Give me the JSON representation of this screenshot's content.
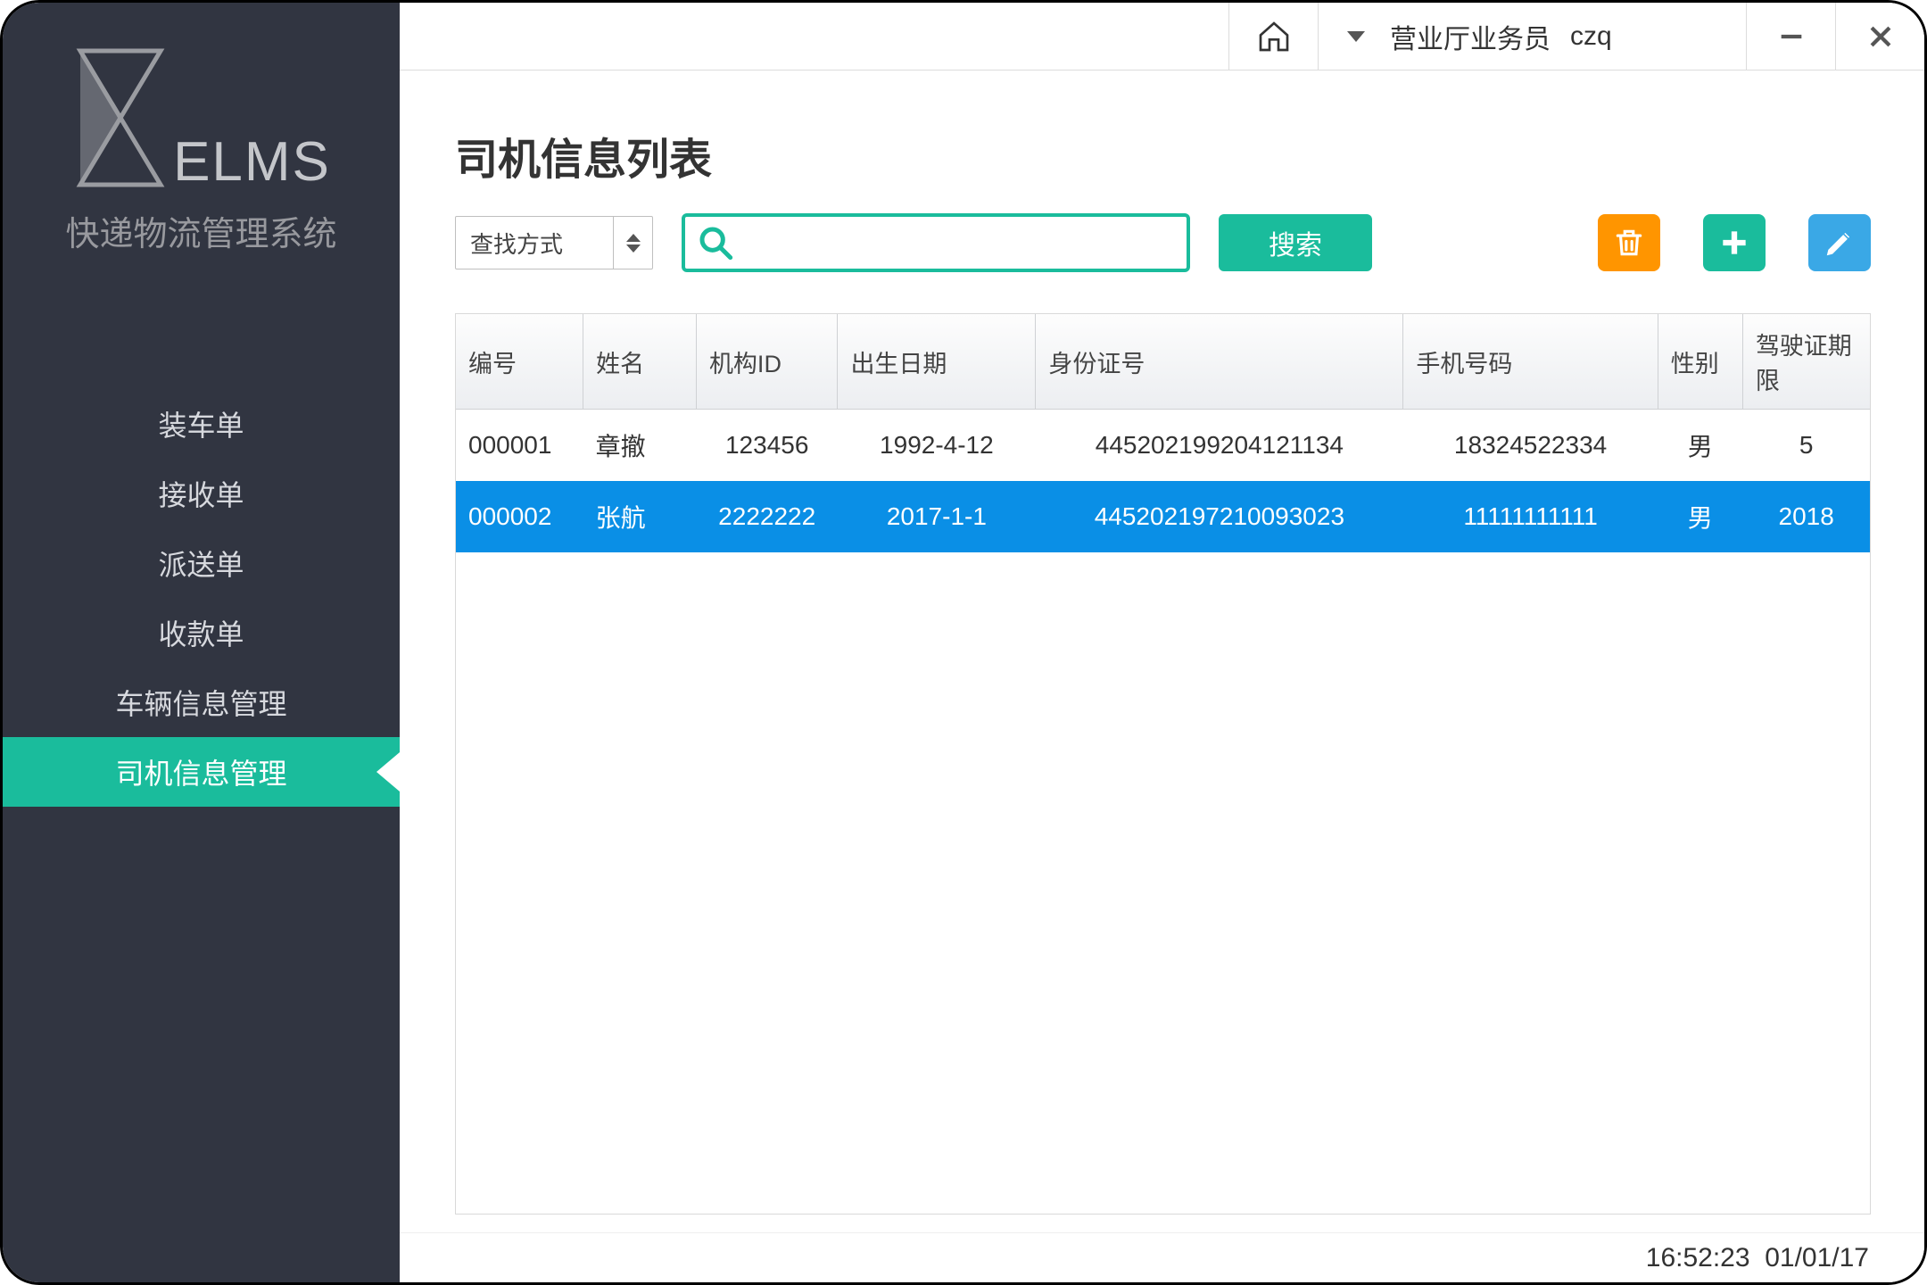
{
  "app": {
    "name": "ELMS",
    "subtitle": "快递物流管理系统"
  },
  "sidebar": {
    "items": [
      {
        "label": "装车单"
      },
      {
        "label": "接收单"
      },
      {
        "label": "派送单"
      },
      {
        "label": "收款单"
      },
      {
        "label": "车辆信息管理"
      },
      {
        "label": "司机信息管理"
      }
    ],
    "activeIndex": 5
  },
  "topbar": {
    "user_role": "营业厅业务员",
    "user_name": "czq"
  },
  "page": {
    "title": "司机信息列表"
  },
  "toolbar": {
    "select_label": "查找方式",
    "search_value": "",
    "search_button": "搜索"
  },
  "table": {
    "columns": [
      "编号",
      "姓名",
      "机构ID",
      "出生日期",
      "身份证号",
      "手机号码",
      "性别",
      "驾驶证期限"
    ],
    "rows": [
      {
        "id": "000001",
        "name": "章撤",
        "org": "123456",
        "birth": "1992-4-12",
        "card": "445202199204121134",
        "phone": "18324522334",
        "sex": "男",
        "lic": "5",
        "selected": false
      },
      {
        "id": "000002",
        "name": "张航",
        "org": "2222222",
        "birth": "2017-1-1",
        "card": "445202197210093023",
        "phone": "11111111111",
        "sex": "男",
        "lic": "2018",
        "selected": true
      }
    ]
  },
  "status": {
    "time": "16:52:23",
    "date": "01/01/17"
  }
}
